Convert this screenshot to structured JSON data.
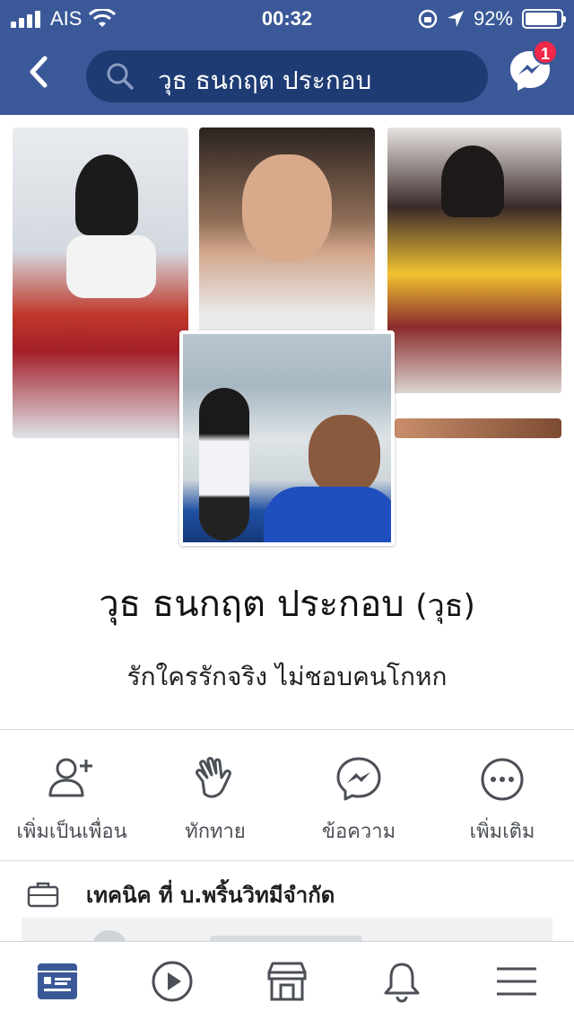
{
  "status_bar": {
    "carrier": "AIS",
    "time": "00:32",
    "battery_percent": "92%",
    "battery_level": 0.92
  },
  "nav": {
    "search_text": "วุธ ธนกฤต ประกอบ",
    "messenger_badge": "1"
  },
  "profile": {
    "name": "วุธ ธนกฤต ประกอบ",
    "alternate_name": "(วุธ)",
    "bio": "รักใครรักจริง ไม่ชอบคนโกหก"
  },
  "actions": [
    {
      "label": "เพิ่มเป็นเพื่อน",
      "icon": "add-friend-icon"
    },
    {
      "label": "ทักทาย",
      "icon": "wave-icon"
    },
    {
      "label": "ข้อความ",
      "icon": "messenger-icon"
    },
    {
      "label": "เพิ่มเติม",
      "icon": "more-icon"
    }
  ],
  "work": {
    "text": "เทคนิค ที่ บ.พริ้นวิทมีจำกัด",
    "icon": "briefcase-icon"
  },
  "tabs": [
    {
      "name": "news-feed",
      "icon": "news-feed-icon",
      "active": true
    },
    {
      "name": "watch",
      "icon": "play-icon",
      "active": false
    },
    {
      "name": "marketplace",
      "icon": "shop-icon",
      "active": false
    },
    {
      "name": "notifications",
      "icon": "bell-icon",
      "active": false
    },
    {
      "name": "menu",
      "icon": "hamburger-icon",
      "active": false
    }
  ],
  "colors": {
    "brand": "#3b5998",
    "search_bg": "#1e3b73",
    "badge": "#f02849",
    "active_tab": "#3b5998"
  }
}
